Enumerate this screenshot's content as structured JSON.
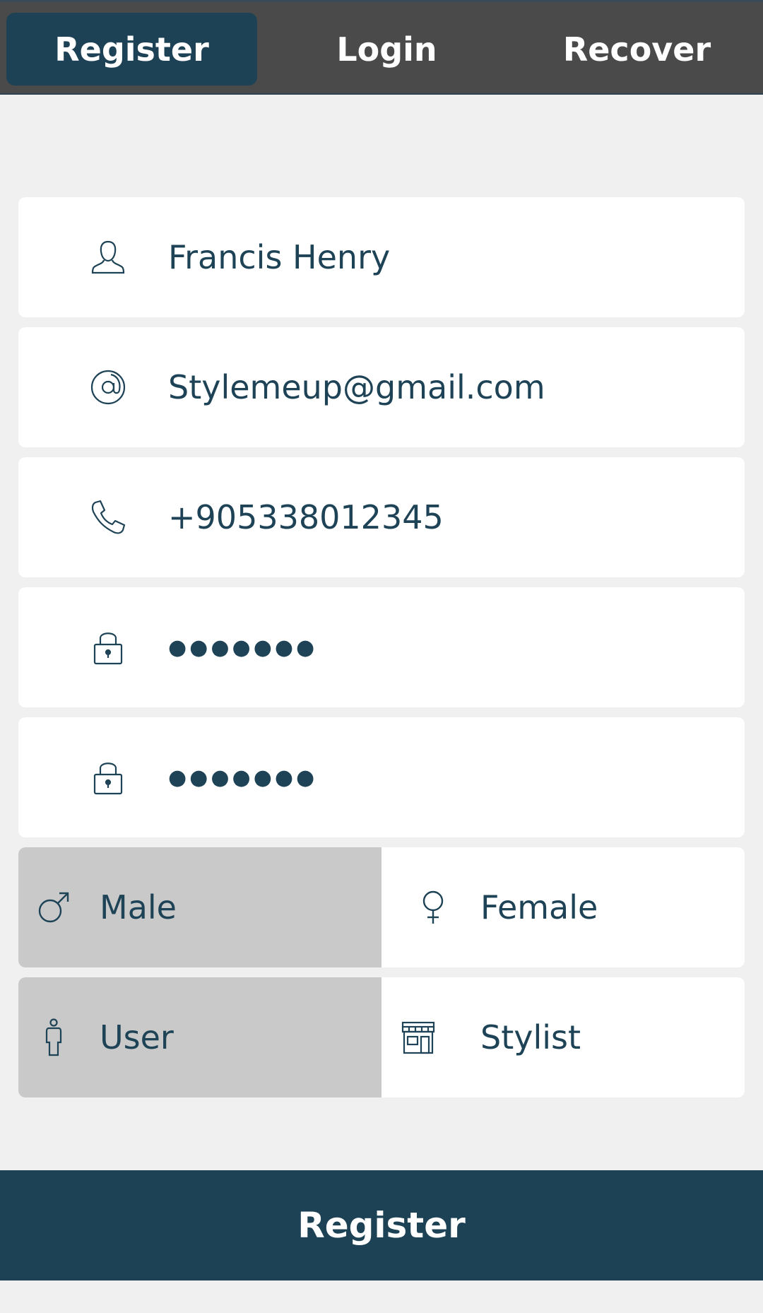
{
  "tabs": {
    "register": "Register",
    "login": "Login",
    "recover": "Recover",
    "active": "register"
  },
  "form": {
    "name": {
      "icon": "user-icon",
      "value": "Francis Henry"
    },
    "email": {
      "icon": "at-icon",
      "value": "Stylemeup@gmail.com"
    },
    "phone": {
      "icon": "phone-icon",
      "value": "+905338012345"
    },
    "password": {
      "icon": "lock-icon",
      "value": "●●●●●●●"
    },
    "confirm_password": {
      "icon": "lock-icon",
      "value": "●●●●●●●"
    }
  },
  "gender": {
    "male": {
      "icon": "male-icon",
      "label": "Male"
    },
    "female": {
      "icon": "female-icon",
      "label": "Female"
    },
    "selected": "male"
  },
  "account_type": {
    "user": {
      "icon": "person-icon",
      "label": "User"
    },
    "stylist": {
      "icon": "store-icon",
      "label": "Stylist"
    },
    "selected": "user"
  },
  "submit": {
    "label": "Register"
  },
  "colors": {
    "accent": "#1d4255",
    "topbar": "#4a4a4a",
    "background": "#f0f0f0",
    "selected_segment": "#c9c9c9",
    "text": "#1e4356"
  }
}
